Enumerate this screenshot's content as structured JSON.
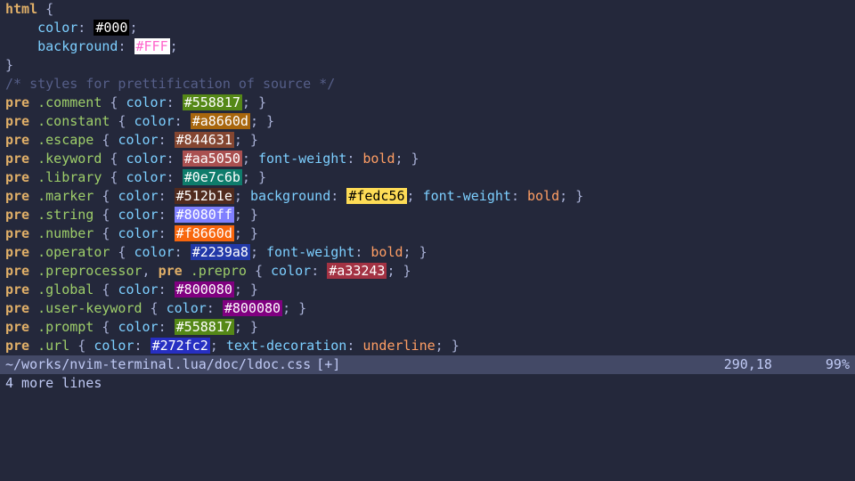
{
  "lines": [
    {
      "kind": "open_sel",
      "selector_html": [
        "html"
      ]
    },
    {
      "kind": "decl_hex",
      "prop": "color",
      "hex": "#000",
      "bg": "#000000",
      "fg": "#ffffff",
      "indent": "    "
    },
    {
      "kind": "decl_hex",
      "prop": "background",
      "hex": "#FFF",
      "bg": "#ffffff",
      "fg": "#ff66cc",
      "indent": "    "
    },
    {
      "kind": "close"
    },
    {
      "kind": "comment",
      "text": "/* styles for prettification of source */"
    },
    {
      "kind": "rule_hex",
      "sel_pre": "pre",
      "sel_class": ".comment",
      "prop": "color",
      "hex": "#558817",
      "bg": "#558817",
      "fg": "#ffffff"
    },
    {
      "kind": "rule_hex",
      "sel_pre": "pre",
      "sel_class": ".constant",
      "prop": "color",
      "hex": "#a8660d",
      "bg": "#a8660d",
      "fg": "#ffffff"
    },
    {
      "kind": "rule_hex",
      "sel_pre": "pre",
      "sel_class": ".escape",
      "prop": "color",
      "hex": "#844631",
      "bg": "#844631",
      "fg": "#ffffff"
    },
    {
      "kind": "rule_hex_bold",
      "sel_pre": "pre",
      "sel_class": ".keyword",
      "prop": "color",
      "hex": "#aa5050",
      "bg": "#aa5050",
      "fg": "#ffffff",
      "bold": "bold"
    },
    {
      "kind": "rule_hex",
      "sel_pre": "pre",
      "sel_class": ".library",
      "prop": "color",
      "hex": "#0e7c6b",
      "bg": "#0e7c6b",
      "fg": "#ffffff"
    },
    {
      "kind": "rule_marker",
      "sel_pre": "pre",
      "sel_class": ".marker",
      "prop1": "color",
      "hex1": "#512b1e",
      "bg1": "#512b1e",
      "fg1": "#ffffff",
      "prop2": "background",
      "hex2": "#fedc56",
      "bg2": "#fedc56",
      "fg2": "#000000",
      "bold": "bold"
    },
    {
      "kind": "rule_hex",
      "sel_pre": "pre",
      "sel_class": ".string",
      "prop": "color",
      "hex": "#8080ff",
      "bg": "#8080ff",
      "fg": "#ffffff"
    },
    {
      "kind": "rule_hex",
      "sel_pre": "pre",
      "sel_class": ".number",
      "prop": "color",
      "hex": "#f8660d",
      "bg": "#f8660d",
      "fg": "#ffffff"
    },
    {
      "kind": "rule_hex_bold",
      "sel_pre": "pre",
      "sel_class": ".operator",
      "prop": "color",
      "hex": "#2239a8",
      "bg": "#2239a8",
      "fg": "#ffffff",
      "bold": "bold"
    },
    {
      "kind": "rule_multi",
      "selectors": [
        [
          "pre",
          ".preprocessor"
        ],
        [
          "pre",
          ".prepro"
        ]
      ],
      "prop": "color",
      "hex": "#a33243",
      "bg": "#a33243",
      "fg": "#ffffff"
    },
    {
      "kind": "rule_hex",
      "sel_pre": "pre",
      "sel_class": ".global",
      "prop": "color",
      "hex": "#800080",
      "bg": "#800080",
      "fg": "#ffffff"
    },
    {
      "kind": "rule_hex",
      "sel_pre": "pre",
      "sel_class": ".user-keyword",
      "prop": "color",
      "hex": "#800080",
      "bg": "#800080",
      "fg": "#ffffff"
    },
    {
      "kind": "rule_hex",
      "sel_pre": "pre",
      "sel_class": ".prompt",
      "prop": "color",
      "hex": "#558817",
      "bg": "#558817",
      "fg": "#ffffff"
    },
    {
      "kind": "rule_url",
      "sel_pre": "pre",
      "sel_class": ".url",
      "prop1": "color",
      "hex": "#272fc2",
      "bg": "#272fc2",
      "fg": "#ffffff",
      "prop2": "text-decoration",
      "val2": "underline"
    }
  ],
  "status": {
    "path": "~/works/nvim-terminal.lua/doc/ldoc.css",
    "modified": "[+]",
    "position": "290,18",
    "percent": "99%"
  },
  "message": "4 more lines"
}
